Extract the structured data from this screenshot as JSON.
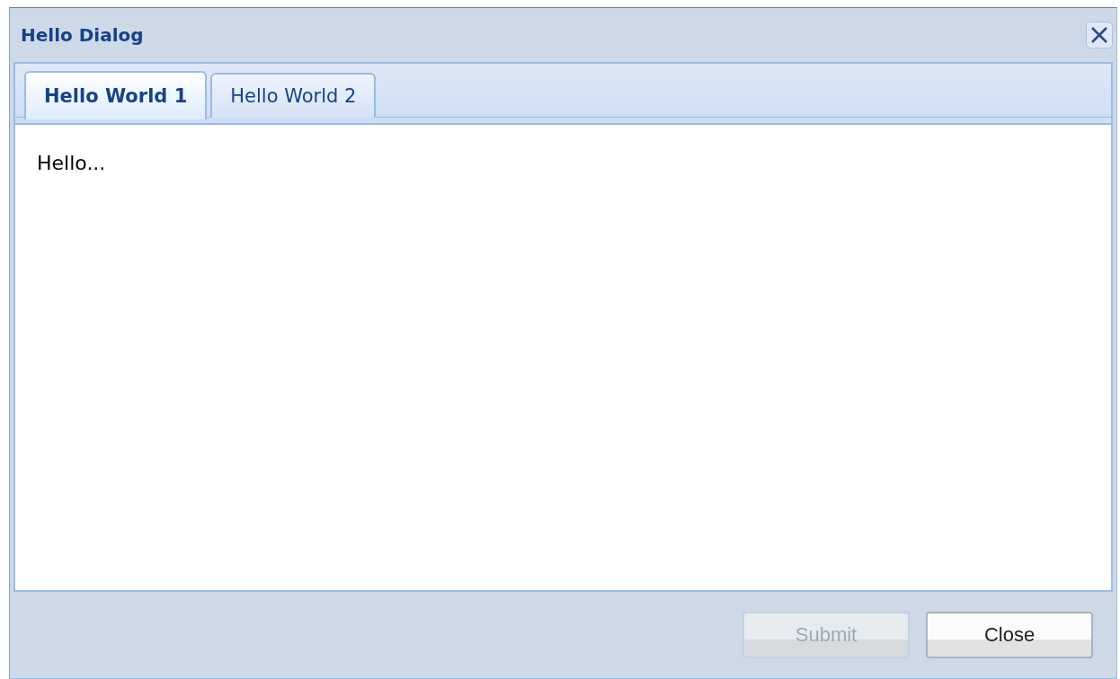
{
  "window": {
    "title": "Hello Dialog"
  },
  "tabs": [
    {
      "label": "Hello World 1",
      "selected": true
    },
    {
      "label": "Hello World 2",
      "selected": false
    }
  ],
  "content": {
    "text": "Hello..."
  },
  "buttons": [
    {
      "label": "Submit",
      "disabled": true
    },
    {
      "label": "Close",
      "disabled": false
    }
  ]
}
